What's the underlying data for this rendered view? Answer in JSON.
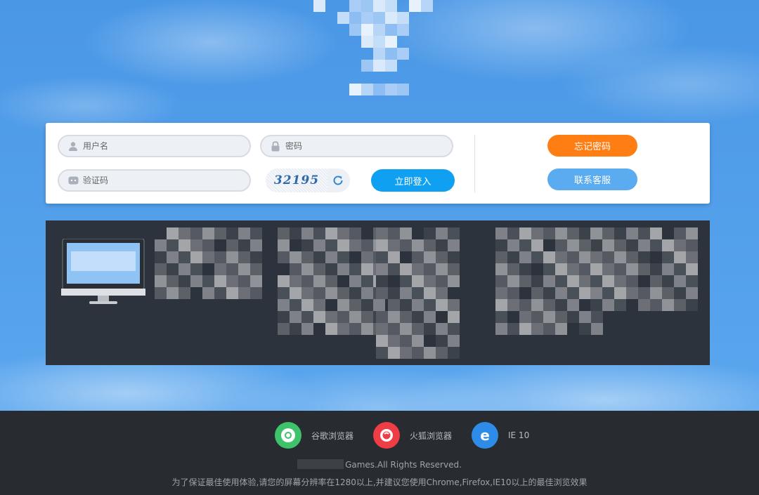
{
  "login": {
    "username_placeholder": "用户名",
    "password_placeholder": "密码",
    "captcha_placeholder": "验证码",
    "captcha_code": "32195",
    "login_button": "立即登入",
    "forgot_password_button": "忘记密码",
    "contact_support_button": "联系客服"
  },
  "colors": {
    "login_button": "#0fa0f2",
    "forgot_password_button": "#ff7e14",
    "contact_support_button": "#5aabf0"
  },
  "footer": {
    "browsers": [
      {
        "name": "谷歌浏览器",
        "icon": "chrome-icon"
      },
      {
        "name": "火狐浏览器",
        "icon": "firefox-icon"
      },
      {
        "name": "IE 10",
        "icon": "ie-icon"
      }
    ],
    "copyright": "Games.All Rights Reserved.",
    "notice": "为了保证最佳使用体验,请您的屏幕分辨率在1280以上,并建议您使用Chrome,Firefox,IE10以上的最佳浏览效果"
  }
}
